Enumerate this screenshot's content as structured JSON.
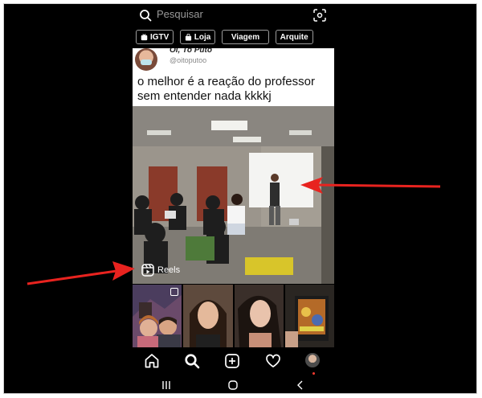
{
  "search": {
    "placeholder": "Pesquisar"
  },
  "chips": [
    {
      "label": "IGTV",
      "icon": "tv-icon"
    },
    {
      "label": "Loja",
      "icon": "shopping-bag-icon"
    },
    {
      "label": "Viagem",
      "icon": ""
    },
    {
      "label": "Arquite",
      "icon": ""
    }
  ],
  "post": {
    "author": "Oi, To Puto",
    "handle": "@oitoputoo",
    "caption": "o melhor é a reação do professor sem entender nada kkkkj",
    "badge_label": "Reels"
  },
  "colors": {
    "arrow": "#e8231f",
    "background": "#000000",
    "card": "#ffffff"
  },
  "thumbnails": [
    {
      "icon": "multi-photo-icon"
    },
    {
      "icon": ""
    },
    {
      "icon": ""
    },
    {
      "icon": ""
    }
  ],
  "bottom_nav": [
    "home-icon",
    "search-icon",
    "add-post-icon",
    "heart-icon",
    "profile-avatar"
  ],
  "system_nav": [
    "recent-apps-icon",
    "home-circle-icon",
    "back-icon"
  ]
}
